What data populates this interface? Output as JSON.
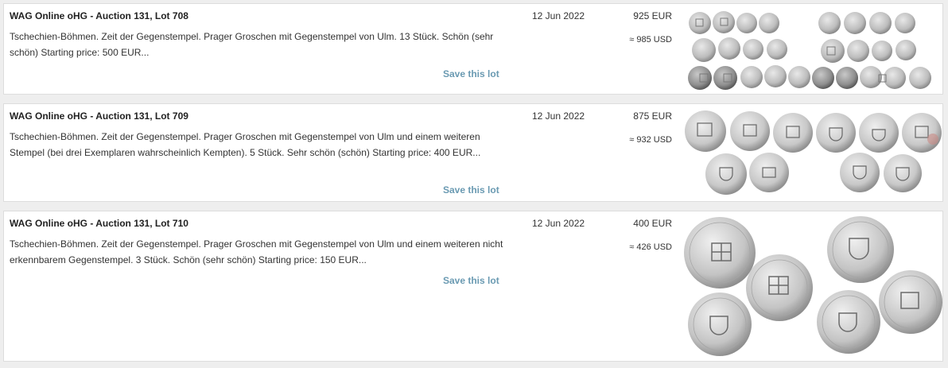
{
  "lots": [
    {
      "title": "WAG Online oHG - Auction 131, Lot 708",
      "description": "Tschechien-Böhmen. Zeit der Gegenstempel. Prager Groschen mit Gegenstempel von Ulm. 13 Stück. Schön (sehr schön) Starting price: 500 EUR...",
      "date": "12 Jun 2022",
      "price": "925 EUR",
      "price_usd": "≈ 985 USD",
      "save_label": "Save this lot",
      "image_icon": "coin-lot-photo"
    },
    {
      "title": "WAG Online oHG - Auction 131, Lot 709",
      "description": "Tschechien-Böhmen. Zeit der Gegenstempel. Prager Groschen mit Gegenstempel von Ulm und einem weiteren Stempel (bei drei Exemplaren wahrscheinlich Kempten). 5 Stück. Sehr schön (schön) Starting price: 400 EUR...",
      "date": "12 Jun 2022",
      "price": "875 EUR",
      "price_usd": "≈ 932 USD",
      "save_label": "Save this lot",
      "image_icon": "coin-lot-photo"
    },
    {
      "title": "WAG Online oHG - Auction 131, Lot 710",
      "description": "Tschechien-Böhmen. Zeit der Gegenstempel. Prager Groschen mit Gegenstempel von Ulm und einem weiteren nicht erkennbarem Gegenstempel. 3 Stück. Schön (sehr schön) Starting price: 150 EUR...",
      "date": "12 Jun 2022",
      "price": "400 EUR",
      "price_usd": "≈ 426 USD",
      "save_label": "Save this lot",
      "image_icon": "coin-lot-photo"
    }
  ],
  "colors": {
    "background": "#eeeeee",
    "card": "#ffffff",
    "link": "#6a9ab2",
    "coin_light": "#d9d9d9",
    "coin_dark": "#8a8a8a"
  }
}
